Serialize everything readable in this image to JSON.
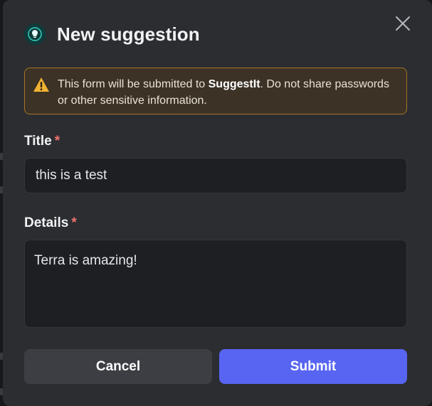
{
  "dialog": {
    "title": "New suggestion",
    "app_icon": "lightbulb-icon",
    "close_icon": "close-icon"
  },
  "warning": {
    "icon": "warning-triangle-icon",
    "text_before": "This form will be submitted to ",
    "app_name": "SuggestIt",
    "text_after": ". Do not share passwords or other sensitive information."
  },
  "fields": {
    "title": {
      "label": "Title",
      "required_mark": "*",
      "value": "this is a test"
    },
    "details": {
      "label": "Details",
      "required_mark": "*",
      "value": "Terra is amazing!"
    }
  },
  "buttons": {
    "cancel": "Cancel",
    "submit": "Submit"
  },
  "colors": {
    "modal_bg": "#2b2d31",
    "input_bg": "#1e1f22",
    "warning_border": "#a67523",
    "required": "#f0726b",
    "primary": "#5865f2"
  }
}
